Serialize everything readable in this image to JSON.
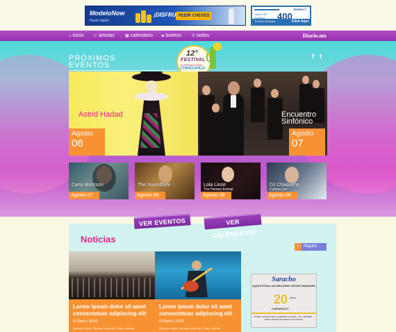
{
  "ads": {
    "ad1": {
      "brand": "ModeloNow",
      "slogan": "¡DISFRUTA!",
      "cta": "PEDIR CHEVES",
      "sub": "Hazlo rápido"
    },
    "ad2": {
      "line1": "Hasta 400 registros",
      "number": "400",
      "brand": "GENPACT",
      "foot": "Tú Eres Genpact.",
      "cta": "Click Aquí"
    },
    "ad3": {
      "brand": "Saracho",
      "tagline": "AQUÍ ESTÁN LAS MEJORES OPORTUNIDADES",
      "anniversary": "20",
      "anos": "años",
      "make": "CHEVROLET",
      "address": "PASEO TRIUNFO DE LA REPÚBLICA #3600 · TEL. 688-8989 · WWW.CHEVROLETSARACHO.COM.MX"
    }
  },
  "nav": {
    "items": [
      {
        "label": "inicio",
        "icon": "home-icon",
        "glyph": "⌂"
      },
      {
        "label": "artistas",
        "icon": "people-icon",
        "glyph": "☺"
      },
      {
        "label": "calendario",
        "icon": "calendar-icon",
        "glyph": "▦"
      },
      {
        "label": "boletos",
        "icon": "ticket-icon",
        "glyph": "▰"
      },
      {
        "label": "sedes",
        "icon": "location-pin-icon",
        "glyph": "⚲"
      }
    ],
    "logo": "Diario.mx"
  },
  "hero": {
    "heading": "PRÓXIMOS EVENTOS",
    "festival": {
      "edition": "12°",
      "line1": "FESTIVAL",
      "line2": "INTERNACIONAL",
      "line3": "CHIHUAHUA"
    },
    "social": {
      "facebook": "f",
      "twitter": "t"
    },
    "featured": [
      {
        "name": "Astrid Hadad",
        "month": "Agosto",
        "day": "06"
      },
      {
        "name": "Encuentro Sinfónico",
        "month": "Agosto",
        "day": "07"
      }
    ],
    "events": [
      {
        "name": "Carla Morrison",
        "sub": "",
        "date": "Agosto 07"
      },
      {
        "name": "The Soundbyte",
        "sub": "",
        "date": "Agosto 08"
      },
      {
        "name": "Lola Lince",
        "sub": "The Human Animal",
        "date": "Agosto 08"
      },
      {
        "name": "DJ Chaqueño",
        "sub": "Cultura Set",
        "date": "Agosto 09"
      }
    ]
  },
  "buttons": {
    "events": "VER EVENTOS",
    "calendar": "VER CALENDARIO"
  },
  "news": {
    "title": "Noticias",
    "playlist": "Playlist",
    "cards": [
      {
        "headline": "Lorem ipsum dolor sit amet consectetuer adipiscing elit",
        "source": "El Diario | 06:50",
        "excerpt": "Quisque rutrum. Aenean imperdiet. Etiam ultricies"
      },
      {
        "headline": "Lorem ipsum dolor sit amet consectetuer adipiscing elit",
        "source": "El Diario | 06:50",
        "excerpt": "Quisque rutrum. Aenean imperdiet. Etiam ultricies"
      }
    ]
  },
  "colors": {
    "purple": "#9a3fbb",
    "orange": "#f79233",
    "pink": "#e2238f",
    "teal": "#d2f3ef"
  }
}
